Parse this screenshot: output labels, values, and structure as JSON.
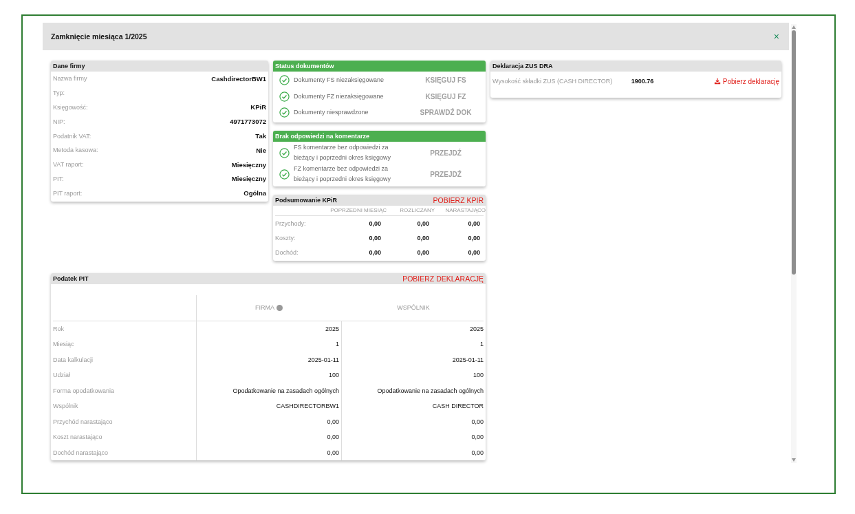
{
  "window": {
    "title": "Zamknięcie miesiąca 1/2025",
    "close": "×"
  },
  "company": {
    "title": "Dane firmy",
    "fields": [
      {
        "label": "Nazwa firmy",
        "value": "CashdirectorBW1"
      },
      {
        "label": "Typ:"
      },
      {
        "label": "Księgowość:",
        "value": "KPiR"
      },
      {
        "label": "NIP:",
        "value": "4971773072"
      },
      {
        "label": "Podatnik VAT:",
        "value": "Tak"
      },
      {
        "label": "Metoda kasowa:",
        "value": "Nie"
      },
      {
        "label": "VAT raport:",
        "value": "Miesięczny"
      },
      {
        "label": "PIT:",
        "value": "Miesięczny"
      },
      {
        "label": "PIT raport:",
        "value": "Ogólna"
      }
    ]
  },
  "document_status": {
    "title": "Status dokumentów",
    "items": [
      {
        "text": "Dokumenty FS niezaksięgowane",
        "ok": true,
        "action": "KSIĘGUJ FS",
        "disabled": true
      },
      {
        "text": "Dokumenty FZ niezaksięgowane",
        "ok": true,
        "action": "KSIĘGUJ FZ",
        "disabled": true
      },
      {
        "text": "Dokumenty niesprawdzone",
        "ok": true,
        "action": "SPRAWDŹ DOK",
        "disabled": true
      }
    ]
  },
  "comments": {
    "title": "Brak odpowiedzi na komentarze",
    "items": [
      {
        "text": "FS komentarze bez odpowiedzi za bieżący i poprzedni okres księgowy",
        "ok": true,
        "action": "PRZEJDŹ",
        "disabled": true
      },
      {
        "text": "FZ komentarze bez odpowiedzi za bieżący i poprzedni okres księgowy",
        "ok": true,
        "action": "PRZEJDŹ",
        "disabled": true
      }
    ]
  },
  "kpir_summary": {
    "title": "Podsumowanie KPiR",
    "action": "POBIERZ KPIR",
    "columns": [
      "POPRZEDNI MIESIĄC",
      "ROZLICZANY",
      "NARASTAJĄCO"
    ],
    "rows": [
      {
        "label": "Przychody:",
        "values": [
          "0,00",
          "0,00",
          "0,00"
        ]
      },
      {
        "label": "Koszty:",
        "values": [
          "0,00",
          "0,00",
          "0,00"
        ]
      },
      {
        "label": "Dochód:",
        "values": [
          "0,00",
          "0,00",
          "0,00"
        ]
      }
    ]
  },
  "zus": {
    "title": "Deklaracja ZUS DRA",
    "rows": [
      {
        "label": "Wysokość składki ZUS (CASH DIRECTOR)",
        "amount": "1900.76",
        "action": "Pobierz deklarację"
      }
    ]
  },
  "pit": {
    "title": "Podatek PIT",
    "action": "POBIERZ DEKLARACJĘ",
    "columns": [
      {
        "label": "FIRMA",
        "info": true
      },
      {
        "label": "WSPÓLNIK",
        "info": false
      }
    ],
    "rows": [
      {
        "label": "Rok",
        "values": [
          "2025",
          "2025"
        ]
      },
      {
        "label": "Miesiąc",
        "values": [
          "1",
          "1"
        ]
      },
      {
        "label": "Data kalkulacji",
        "values": [
          "2025-01-11",
          "2025-01-11"
        ]
      },
      {
        "label": "Udział",
        "values": [
          "100",
          "100"
        ]
      },
      {
        "label": "Forma opodatkowania",
        "values": [
          "Opodatkowanie na zasadach ogólnych",
          "Opodatkowanie na zasadach ogólnych"
        ]
      },
      {
        "label": "Wspólnik",
        "values": [
          "CASHDIRECTORBW1",
          "CASH DIRECTOR"
        ]
      },
      {
        "label": "Przychód narastająco",
        "values": [
          "0,00",
          "0,00"
        ]
      },
      {
        "label": "Koszt narastająco",
        "values": [
          "0,00",
          "0,00"
        ]
      },
      {
        "label": "Dochód narastająco",
        "values": [
          "0,00",
          "0,00"
        ]
      }
    ]
  }
}
